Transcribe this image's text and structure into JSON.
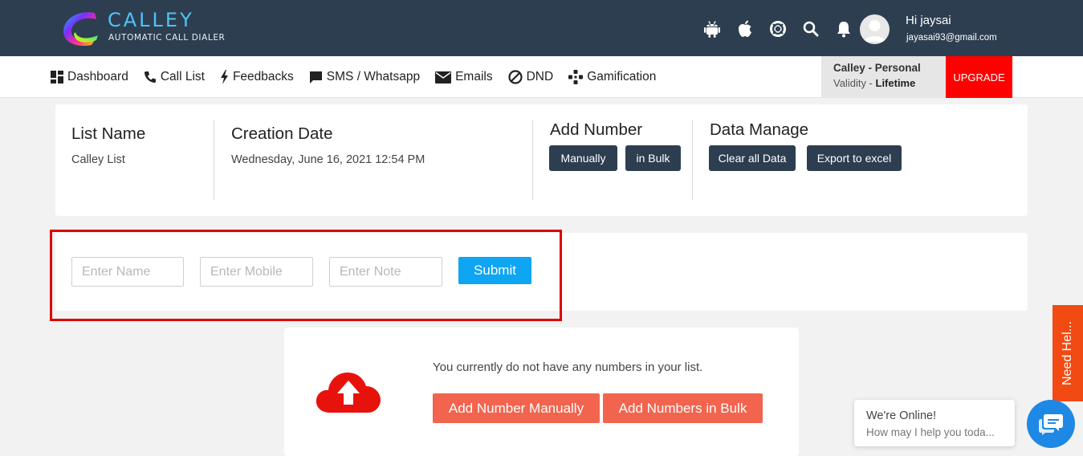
{
  "header": {
    "logo_title": "CALLEY",
    "logo_subtitle": "AUTOMATIC CALL DIALER",
    "icons": [
      "android-icon",
      "apple-icon",
      "support-icon",
      "search-icon",
      "bell-icon"
    ],
    "greeting": "Hi jaysai",
    "email": "jayasai93@gmail.com"
  },
  "nav": {
    "items": [
      {
        "label": "Dashboard",
        "icon": "dashboard-icon"
      },
      {
        "label": "Call List",
        "icon": "phone-icon"
      },
      {
        "label": "Feedbacks",
        "icon": "bolt-icon"
      },
      {
        "label": "SMS / Whatsapp",
        "icon": "chat-icon"
      },
      {
        "label": "Emails",
        "icon": "envelope-icon"
      },
      {
        "label": "DND",
        "icon": "ban-icon"
      },
      {
        "label": "Gamification",
        "icon": "gamepad-icon"
      }
    ],
    "plan_name": "Calley - Personal",
    "validity_label": "Validity - ",
    "validity_value": "Lifetime",
    "upgrade_label": "UPGRADE"
  },
  "list_info": {
    "list_name_title": "List Name",
    "list_name": "Calley List",
    "creation_date_title": "Creation Date",
    "creation_date": "Wednesday, June 16, 2021 12:54 PM",
    "add_number_title": "Add Number",
    "manually_label": "Manually",
    "in_bulk_label": "in Bulk",
    "data_manage_title": "Data Manage",
    "clear_all_label": "Clear all Data",
    "export_label": "Export to excel"
  },
  "form": {
    "name_placeholder": "Enter Name",
    "mobile_placeholder": "Enter Mobile",
    "note_placeholder": "Enter Note",
    "submit_label": "Submit"
  },
  "empty_state": {
    "message": "You currently do not have any numbers in your list.",
    "add_manually_label": "Add Number Manually",
    "add_bulk_label": "Add Numbers in Bulk"
  },
  "help_tab": {
    "label": "Need Hel..."
  },
  "chat": {
    "title": "We're Online!",
    "subtitle": "How may I help you toda..."
  },
  "colors": {
    "header_bg": "#2d3e50",
    "upgrade_bg": "#ff0000",
    "submit_bg": "#0ea5f3",
    "orange_button": "#f2644e",
    "cloud_red": "#e8120c",
    "help_tab_bg": "#f24a13",
    "chat_button": "#1e88e5"
  }
}
